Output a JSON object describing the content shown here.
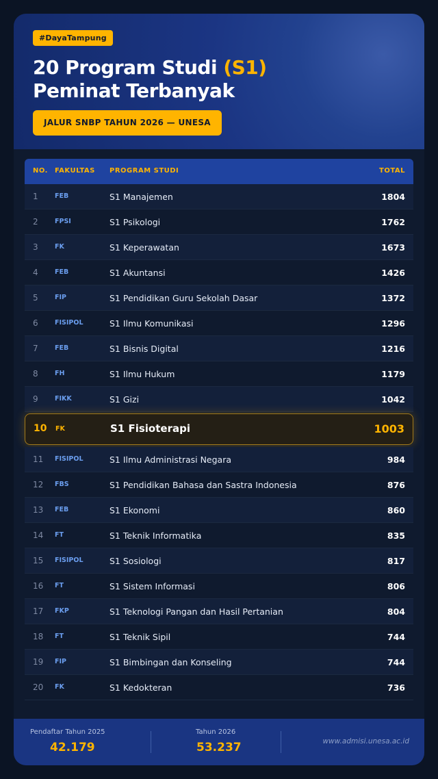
{
  "header": {
    "tag": "#DayaTampung",
    "title_line1_prefix": "20 Program Studi ",
    "title_line1_highlight": "(S1)",
    "title_line2": "Peminat Terbanyak",
    "subtitle": "JALUR SNBP TAHUN 2026 — UNESA"
  },
  "table": {
    "headers": {
      "no": "NO.",
      "fakultas": "FAKULTAS",
      "program": "PROGRAM STUDI",
      "total": "TOTAL"
    },
    "rows": [
      {
        "no": "1",
        "fakultas": "FEB",
        "program": "S1 Manajemen",
        "total": "1804"
      },
      {
        "no": "2",
        "fakultas": "FPSI",
        "program": "S1 Psikologi",
        "total": "1762"
      },
      {
        "no": "3",
        "fakultas": "FK",
        "program": "S1 Keperawatan",
        "total": "1673"
      },
      {
        "no": "4",
        "fakultas": "FEB",
        "program": "S1 Akuntansi",
        "total": "1426"
      },
      {
        "no": "5",
        "fakultas": "FIP",
        "program": "S1 Pendidikan Guru Sekolah Dasar",
        "total": "1372"
      },
      {
        "no": "6",
        "fakultas": "FISIPOL",
        "program": "S1 Ilmu Komunikasi",
        "total": "1296"
      },
      {
        "no": "7",
        "fakultas": "FEB",
        "program": "S1 Bisnis Digital",
        "total": "1216"
      },
      {
        "no": "8",
        "fakultas": "FH",
        "program": "S1 Ilmu Hukum",
        "total": "1179"
      },
      {
        "no": "9",
        "fakultas": "FIKK",
        "program": "S1 Gizi",
        "total": "1042"
      },
      {
        "no": "10",
        "fakultas": "FK",
        "program": "S1 Fisioterapi",
        "total": "1003"
      },
      {
        "no": "11",
        "fakultas": "FISIPOL",
        "program": "S1 Ilmu Administrasi Negara",
        "total": "984"
      },
      {
        "no": "12",
        "fakultas": "FBS",
        "program": "S1 Pendidikan Bahasa dan Sastra Indonesia",
        "total": "876"
      },
      {
        "no": "13",
        "fakultas": "FEB",
        "program": "S1 Ekonomi",
        "total": "860"
      },
      {
        "no": "14",
        "fakultas": "FT",
        "program": "S1 Teknik Informatika",
        "total": "835"
      },
      {
        "no": "15",
        "fakultas": "FISIPOL",
        "program": "S1 Sosiologi",
        "total": "817"
      },
      {
        "no": "16",
        "fakultas": "FT",
        "program": "S1 Sistem Informasi",
        "total": "806"
      },
      {
        "no": "17",
        "fakultas": "FKP",
        "program": "S1 Teknologi Pangan dan Hasil Pertanian",
        "total": "804"
      },
      {
        "no": "18",
        "fakultas": "FT",
        "program": "S1 Teknik Sipil",
        "total": "744"
      },
      {
        "no": "19",
        "fakultas": "FIP",
        "program": "S1 Bimbingan dan Konseling",
        "total": "744"
      },
      {
        "no": "20",
        "fakultas": "FK",
        "program": "S1 Kedokteran",
        "total": "736"
      }
    ]
  },
  "footer": {
    "stat1_label": "Pendaftar Tahun 2025",
    "stat1_value": "42.179",
    "stat2_label": "Tahun 2026",
    "stat2_value": "53.237",
    "url": "www.admisi.unesa.ac.id"
  },
  "colors": {
    "accent": "#ffb400",
    "header_blue": "#1f43a0",
    "background": "#0b1424"
  }
}
